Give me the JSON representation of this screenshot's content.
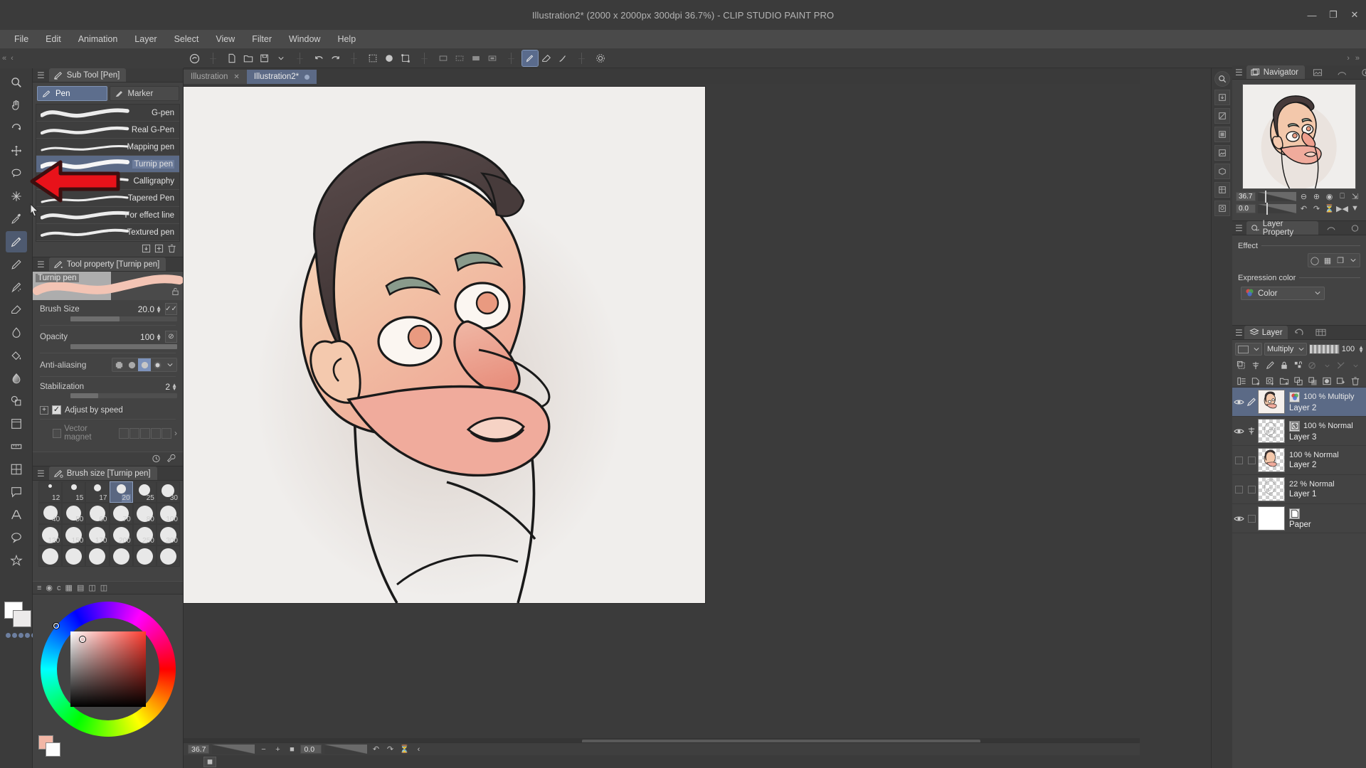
{
  "window": {
    "title": "Illustration2* (2000 x 2000px 300dpi 36.7%)  - CLIP STUDIO PAINT PRO",
    "minimize": "—",
    "maximize": "❐",
    "close": "✕"
  },
  "menu": {
    "items": [
      "File",
      "Edit",
      "Animation",
      "Layer",
      "Select",
      "View",
      "Filter",
      "Window",
      "Help"
    ]
  },
  "command_bar": {
    "collapse_left": "«",
    "collapse_prev": "‹",
    "collapse_right": "»",
    "collapse_next": "›"
  },
  "document_tabs": [
    {
      "label": "Illustration",
      "close": "✕",
      "active": false
    },
    {
      "label": "Illustration2*",
      "modified_dot": "●",
      "active": true
    }
  ],
  "sub_tool": {
    "panel_title": "Sub Tool [Pen]",
    "menu_icon": "hamburger-icon",
    "groups": [
      {
        "label": "Pen",
        "selected": true
      },
      {
        "label": "Marker",
        "selected": false
      }
    ],
    "items": [
      {
        "label": "G-pen",
        "selected": false
      },
      {
        "label": "Real G-Pen",
        "selected": false
      },
      {
        "label": "Mapping pen",
        "selected": false
      },
      {
        "label": "Turnip pen",
        "selected": true
      },
      {
        "label": "Calligraphy",
        "selected": false
      },
      {
        "label": "Tapered Pen",
        "selected": false
      },
      {
        "label": "For effect line",
        "selected": false
      },
      {
        "label": "Textured pen",
        "selected": false
      }
    ],
    "footer_icons": [
      "import-icon",
      "duplicate-icon",
      "delete-icon"
    ]
  },
  "tool_property": {
    "panel_title": "Tool property [Turnip pen]",
    "preview_label": "Turnip pen",
    "lock_icon": "unlock-icon",
    "brush_size": {
      "label": "Brush Size",
      "value": "20.0",
      "fill_pct": 46
    },
    "opacity": {
      "label": "Opacity",
      "value": "100",
      "fill_pct": 100
    },
    "anti_aliasing": {
      "label": "Anti-aliasing",
      "selected_index": 2,
      "options": [
        "none",
        "low",
        "medium",
        "high"
      ]
    },
    "stabilization": {
      "label": "Stabilization",
      "value": "2",
      "fill_pct": 26
    },
    "adjust_by_speed": {
      "label": "Adjust by speed",
      "checked": true,
      "expand": "+"
    },
    "vector_magnet": {
      "label": "Vector magnet",
      "checked": false,
      "arrow": "›"
    },
    "footer_icons": [
      "timer-icon",
      "wrench-icon"
    ]
  },
  "brush_size_panel": {
    "panel_title": "Brush size [Turnip pen]",
    "selected": "20",
    "sizes": [
      [
        "12",
        "15",
        "17",
        "20",
        "25",
        "30"
      ],
      [
        "40",
        "50",
        "60",
        "70",
        "80",
        "100"
      ],
      [
        "120",
        "150",
        "170",
        "200",
        "250",
        "300"
      ],
      [
        "",
        "",
        "",
        "",
        "",
        ""
      ]
    ],
    "footer_icons": [
      "list-icon",
      "circle-icon",
      "c-icon",
      "grid-icon",
      "rows-icon",
      "cols-icon",
      "detail-icon"
    ]
  },
  "navigator": {
    "panel_title": "Navigator",
    "tabs": [
      "navigator-icon",
      "subview-icon",
      "item-bank-icon",
      "info-icon"
    ],
    "zoom_value": "36.7",
    "rotate_value": "0.0",
    "controls": [
      "zoom-out-icon",
      "zoom-in-icon",
      "fit-icon",
      "mirror-icon",
      "fullscreen-icon",
      "rotate-left-icon",
      "rotate-right-icon",
      "reset-rotate-icon",
      "flip-h-icon",
      "flip-v-icon"
    ]
  },
  "layer_property": {
    "panel_title": "Layer Property",
    "tabs": [
      "layer-property-icon",
      "animation-cels-icon",
      "tonal-correction-icon"
    ],
    "effect_label": "Effect",
    "effect_buttons": [
      "border-effect-icon",
      "tone-icon",
      "layer-color-icon",
      "chevron-down-icon"
    ],
    "expression_color_label": "Expression color",
    "expression_color_value": "Color",
    "expression_color_icon": "color-circles-icon"
  },
  "layer_panel": {
    "tabs": [
      {
        "label": "Layer",
        "icon": "layers-icon",
        "active": true
      },
      {
        "label": "",
        "icon": "history-icon",
        "active": false
      },
      {
        "label": "",
        "icon": "animation-icon",
        "active": false
      }
    ],
    "blend_mode": "Multiply",
    "opacity": "100",
    "mask_selector": "▢",
    "toolbar_row1": [
      "clip-to-layer-icon",
      "ref-layer-icon",
      "lock-transparency-icon",
      "lock-layer-icon",
      "ruler-link-icon",
      "mask-enable-icon",
      "mask-show-icon"
    ],
    "toolbar_row2": [
      "layer-settings-icon",
      "new-raster-layer-icon",
      "new-vector-layer-icon",
      "new-folder-icon",
      "transfer-down-icon",
      "combine-down-icon",
      "create-mask-icon",
      "snapshot-icon",
      "delete-layer-icon"
    ],
    "layers": [
      {
        "name": "Layer 2",
        "blend": "100 % Multiply",
        "visible": true,
        "selected": true,
        "thumb": "portrait-color",
        "badge": "color-circles-icon",
        "edit_icon": "pen-icon"
      },
      {
        "name": "Layer 3",
        "blend": "100 % Normal",
        "visible": true,
        "selected": false,
        "thumb": "sketch",
        "badge": "ruler-icon",
        "edit_icon": "ruler-icon"
      },
      {
        "name": "Layer 2",
        "blend": "100 % Normal",
        "visible": false,
        "selected": false,
        "thumb": "portrait-flat",
        "badge": "",
        "edit_icon": ""
      },
      {
        "name": "Layer 1",
        "blend": "22 % Normal",
        "visible": false,
        "selected": false,
        "thumb": "sketch2",
        "badge": "",
        "edit_icon": ""
      },
      {
        "name": "Paper",
        "blend": "",
        "visible": true,
        "selected": false,
        "thumb": "paper",
        "badge": "paper-icon",
        "edit_icon": ""
      }
    ]
  },
  "status_bar": {
    "zoom": "36.7",
    "rotate": "0.0",
    "buttons": [
      "zoom-out-icon",
      "zoom-in-icon",
      "fit-icon",
      "rotate-left-icon",
      "rotate-right-icon",
      "reset-rotation-icon",
      "prev-icon"
    ]
  },
  "annotation": {
    "arrow_color": "#e8121a",
    "arrow_outline": "#3d0f0f",
    "points_to": "Turnip pen"
  },
  "colors": {
    "accent_selected": "#5b6a86",
    "panel_bg": "#434343",
    "app_bg": "#3b3b3b",
    "menu_bg": "#4a4a4a",
    "text": "#dcdcdc",
    "foreground_swatch": "#f2b7a6",
    "background_swatch": "#ffffff"
  }
}
